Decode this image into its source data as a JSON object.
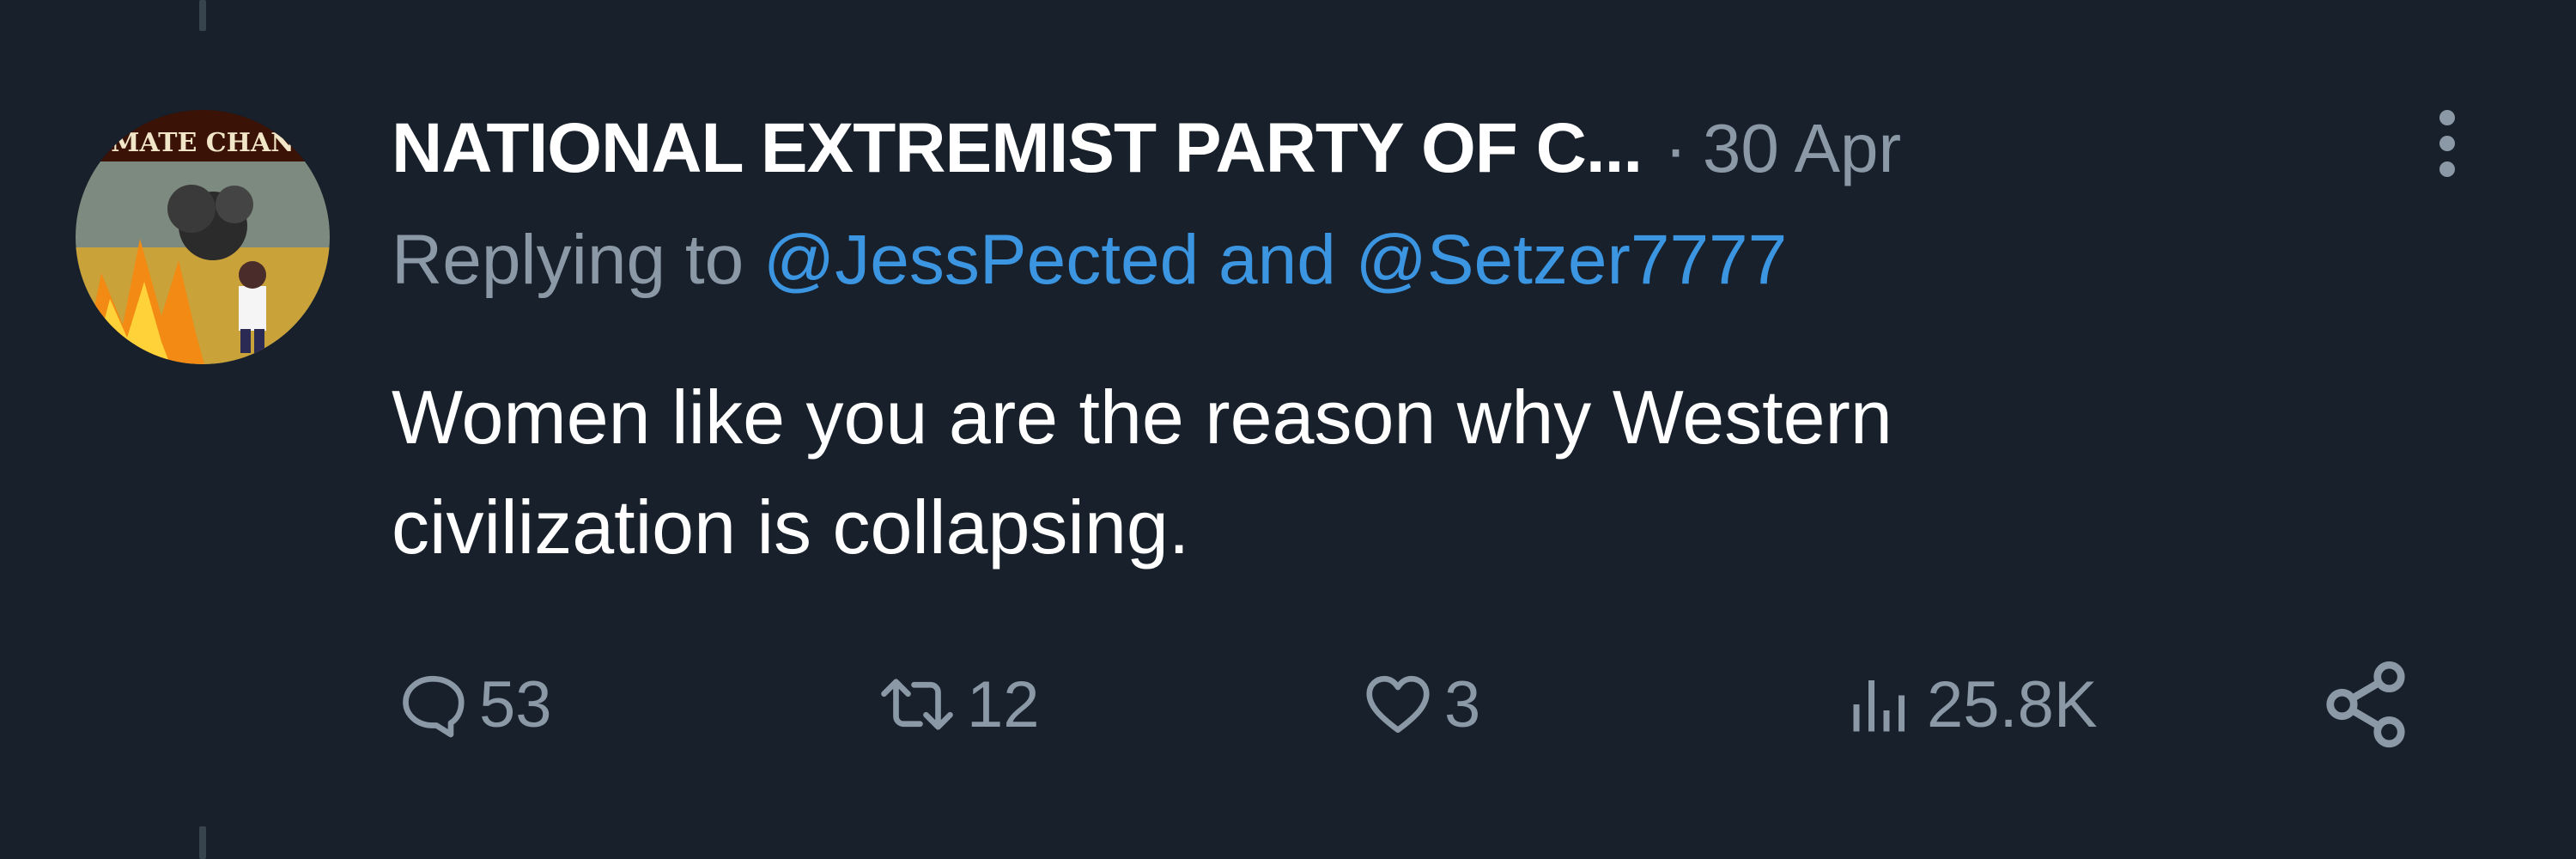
{
  "tweet": {
    "author": "NATIONAL EXTREMIST PARTY OF C...",
    "separator": "·",
    "date": "30 Apr",
    "reply_prefix": "Replying to",
    "mention_1": "@JessPected",
    "reply_and": "and",
    "mention_2": "@Setzer7777",
    "text": "Women like you are the reason why Western\ncivilization is collapsing.",
    "avatar_banner": "MATE CHAN"
  },
  "actions": {
    "replies": "53",
    "reposts": "12",
    "likes": "3",
    "views": "25.8K"
  },
  "icons": {
    "reply": "speech-bubble-icon",
    "repost": "retweet-arrows-icon",
    "like": "heart-icon",
    "views": "bar-chart-icon",
    "share": "share-nodes-icon",
    "more": "vertical-ellipsis-icon"
  },
  "colors": {
    "background": "#18202b",
    "text": "#ffffff",
    "muted": "#8b98a5",
    "link": "#3b95e0"
  }
}
